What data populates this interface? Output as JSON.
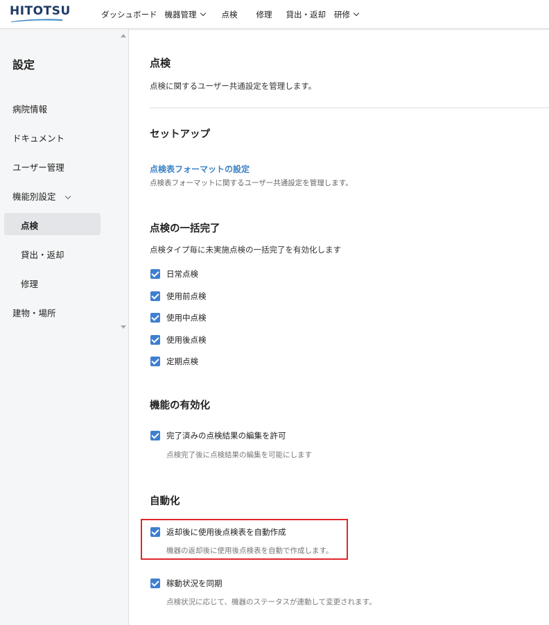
{
  "header": {
    "logo": "HITOTSU",
    "nav": [
      {
        "label": "ダッシュボード",
        "dropdown": false
      },
      {
        "label": "機器管理",
        "dropdown": true
      },
      {
        "label": "点検",
        "dropdown": false
      },
      {
        "label": "修理",
        "dropdown": false
      },
      {
        "label": "貸出・返却",
        "dropdown": false
      },
      {
        "label": "研修",
        "dropdown": true
      }
    ]
  },
  "sidebar": {
    "title": "設定",
    "items": [
      {
        "label": "病院情報"
      },
      {
        "label": "ドキュメント"
      },
      {
        "label": "ユーザー管理"
      },
      {
        "label": "機能別設定",
        "expanded": true
      },
      {
        "label": "点検",
        "active": true
      },
      {
        "label": "貸出・返却"
      },
      {
        "label": "修理"
      },
      {
        "label": "建物・場所"
      }
    ]
  },
  "main": {
    "title": "点検",
    "description": "点検に関するユーザー共通設定を管理します。",
    "setup": {
      "heading": "セットアップ",
      "link": "点検表フォーマットの設定",
      "link_desc": "点検表フォーマットに関するユーザー共通設定を管理します。"
    },
    "bulk": {
      "heading": "点検の一括完了",
      "description": "点検タイプ毎に未実施点検の一括完了を有効化します",
      "options": [
        {
          "label": "日常点検",
          "checked": true
        },
        {
          "label": "使用前点検",
          "checked": true
        },
        {
          "label": "使用中点検",
          "checked": true
        },
        {
          "label": "使用後点検",
          "checked": true
        },
        {
          "label": "定期点検",
          "checked": true
        }
      ]
    },
    "features": {
      "heading": "機能の有効化",
      "option": {
        "label": "完了済みの点検結果の編集を許可",
        "sub": "点検完了後に点検結果の編集を可能にします",
        "checked": true
      }
    },
    "automation": {
      "heading": "自動化",
      "options": [
        {
          "label": "返却後に使用後点検表を自動作成",
          "sub": "機器の返却後に使用後点検表を自動で作成します。",
          "checked": true
        },
        {
          "label": "稼動状況を同期",
          "sub": "点検状況に応じて、機器のステータスが連動して変更されます。",
          "checked": true
        }
      ]
    }
  },
  "colors": {
    "accent": "#3e7fd0",
    "link": "#3b82c4",
    "highlight": "#e0262b",
    "logo": "#1f3a66"
  }
}
